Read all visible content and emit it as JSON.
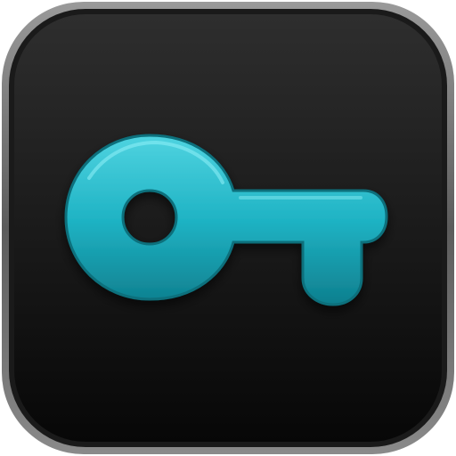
{
  "icon": {
    "name": "key-icon",
    "colors": {
      "bezel_outer": "#8e8e8e",
      "bezel_inner": "#2a2a2a",
      "tile_top": "#2e2e2e",
      "tile_bottom": "#070707",
      "key_light": "#4fd3e0",
      "key_mid": "#1fb3c4",
      "key_dark": "#0e7f8e",
      "key_hole": "#0c0c0c"
    }
  }
}
